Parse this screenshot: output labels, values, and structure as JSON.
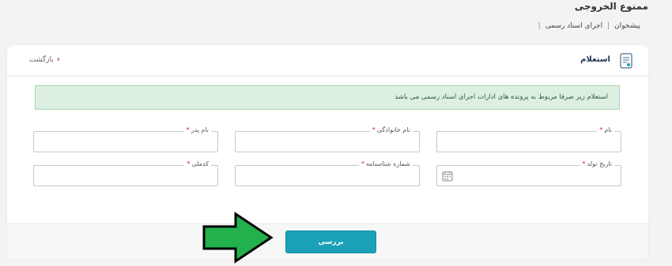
{
  "page": {
    "title": "ممنوع الخروجی"
  },
  "breadcrumb": {
    "items": [
      "پیشخوان",
      "اجرای اسناد رسمی"
    ],
    "separator": "|"
  },
  "card": {
    "title": "استعلام",
    "title_icon": "document-icon",
    "back_label": "بازگشت",
    "back_icon": "chevron-left-icon",
    "alert_text": "استعلام زیر صرفا مربوط به پرونده های ادارات اجرای اسناد رسمی می باشد"
  },
  "form": {
    "required_mark": "*",
    "first_name": {
      "label": "نام",
      "value": ""
    },
    "last_name": {
      "label": "نام خانوادگی",
      "value": ""
    },
    "father_name": {
      "label": "نام پدر",
      "value": ""
    },
    "birth_date": {
      "label": "تاریخ تولد",
      "value": "",
      "icon": "calendar-icon"
    },
    "id_number": {
      "label": "شماره شناسنامه",
      "value": ""
    },
    "national_code": {
      "label": "کدملی",
      "value": ""
    }
  },
  "actions": {
    "submit_label": "بررسی"
  },
  "colors": {
    "accent": "#1aa1b8",
    "alert_bg": "#dcefe1",
    "required": "#d21f1f",
    "arrow_fill": "#22b14c"
  }
}
